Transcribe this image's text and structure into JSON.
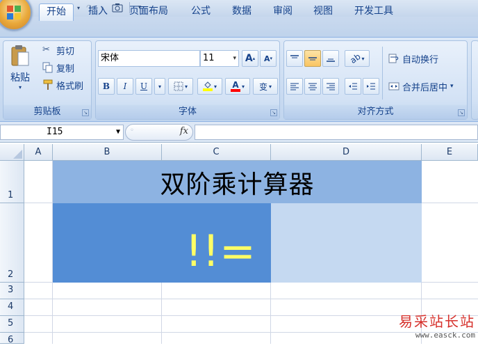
{
  "quick_access": {
    "save_icon": "save-icon",
    "undo_icon": "undo-icon",
    "redo_icon": "redo-icon",
    "camera_icon": "camera-icon",
    "customize_icon": "dropdown-icon"
  },
  "tabs": [
    "开始",
    "插入",
    "页面布局",
    "公式",
    "数据",
    "审阅",
    "视图",
    "开发工具"
  ],
  "active_tab": "开始",
  "clipboard": {
    "paste_label": "粘贴",
    "cut_label": "剪切",
    "copy_label": "复制",
    "format_painter_label": "格式刷",
    "group_label": "剪贴板"
  },
  "font": {
    "font_name": "宋体",
    "font_size": "11",
    "grow_label": "A",
    "shrink_label": "A",
    "bold": "B",
    "italic": "I",
    "underline": "U",
    "fill_color": "#ffff00",
    "font_color": "#ff0000",
    "phonetic_label": "变",
    "group_label": "字体"
  },
  "alignment": {
    "wrap_text_label": "自动换行",
    "merge_center_label": "合并后居中",
    "group_label": "对齐方式"
  },
  "formula_bar": {
    "name_box": "I15",
    "fx_label": "fx",
    "formula": ""
  },
  "columns": [
    "A",
    "B",
    "C",
    "D",
    "E"
  ],
  "rows": [
    "1",
    "2",
    "3",
    "4",
    "5",
    "6"
  ],
  "cells": {
    "title": "双阶乘计算器",
    "expression": "!!=",
    "result": ""
  },
  "colors": {
    "title_fill": "#8db3e2",
    "expression_fill": "#538dd5",
    "expression_text": "#ffff66",
    "result_fill": "#c5d9f1"
  },
  "watermark": {
    "line1": "易采站长站",
    "line2": "www.easck.com"
  }
}
